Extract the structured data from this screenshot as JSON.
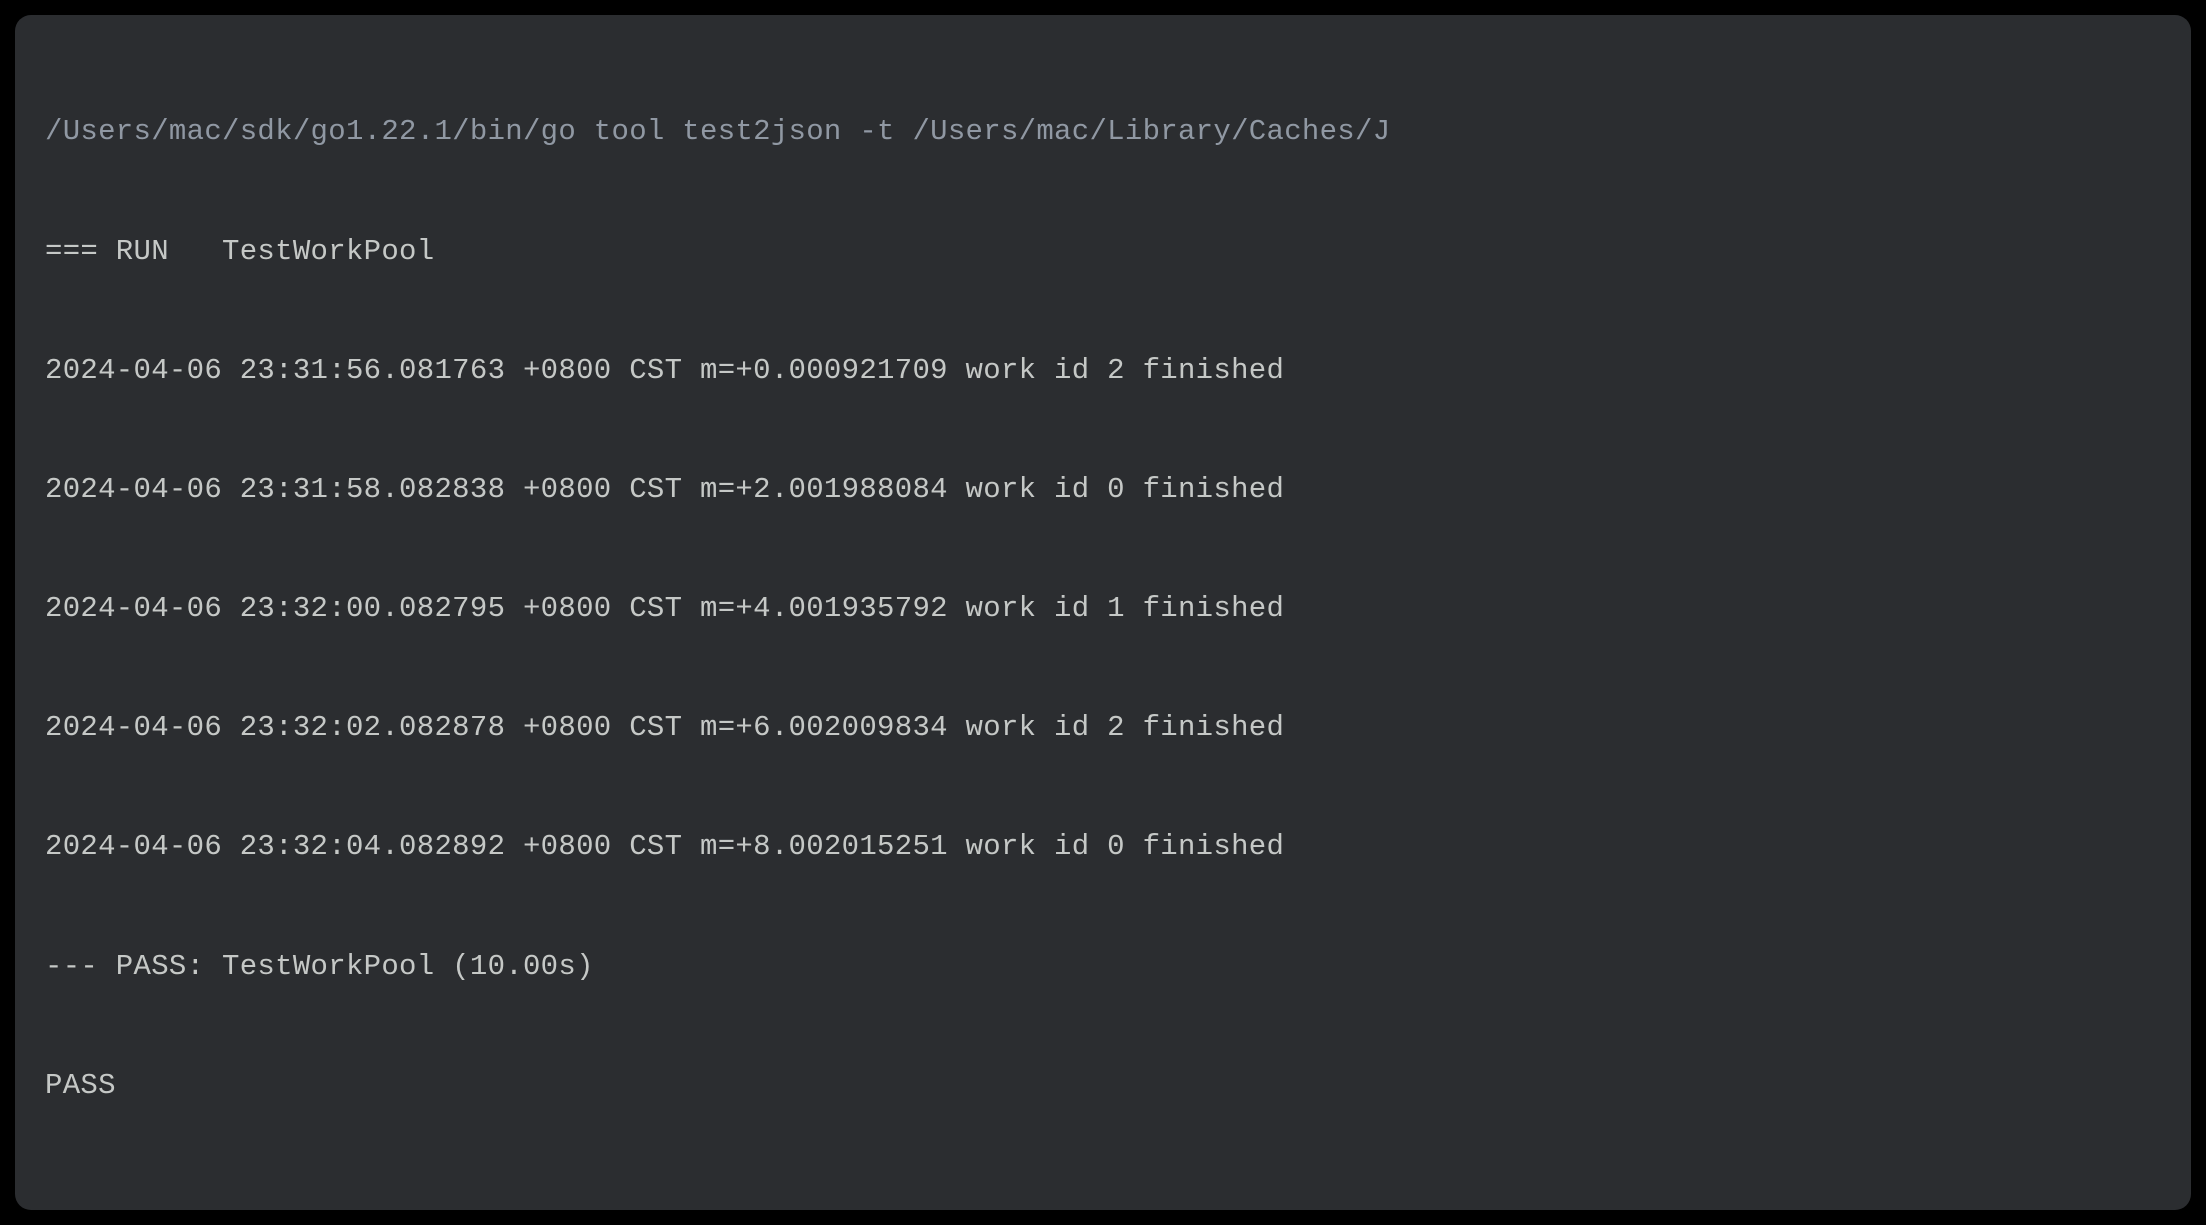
{
  "terminal": {
    "lines": [
      {
        "type": "command",
        "text": "/Users/mac/sdk/go1.22.1/bin/go tool test2json -t /Users/mac/Library/Caches/J"
      },
      {
        "type": "output",
        "text": "=== RUN   TestWorkPool"
      },
      {
        "type": "output",
        "text": "2024-04-06 23:31:56.081763 +0800 CST m=+0.000921709 work id 2 finished"
      },
      {
        "type": "output",
        "text": "2024-04-06 23:31:58.082838 +0800 CST m=+2.001988084 work id 0 finished"
      },
      {
        "type": "output",
        "text": "2024-04-06 23:32:00.082795 +0800 CST m=+4.001935792 work id 1 finished"
      },
      {
        "type": "output",
        "text": "2024-04-06 23:32:02.082878 +0800 CST m=+6.002009834 work id 2 finished"
      },
      {
        "type": "output",
        "text": "2024-04-06 23:32:04.082892 +0800 CST m=+8.002015251 work id 0 finished"
      },
      {
        "type": "output",
        "text": "--- PASS: TestWorkPool (10.00s)"
      },
      {
        "type": "output",
        "text": "PASS"
      }
    ]
  }
}
